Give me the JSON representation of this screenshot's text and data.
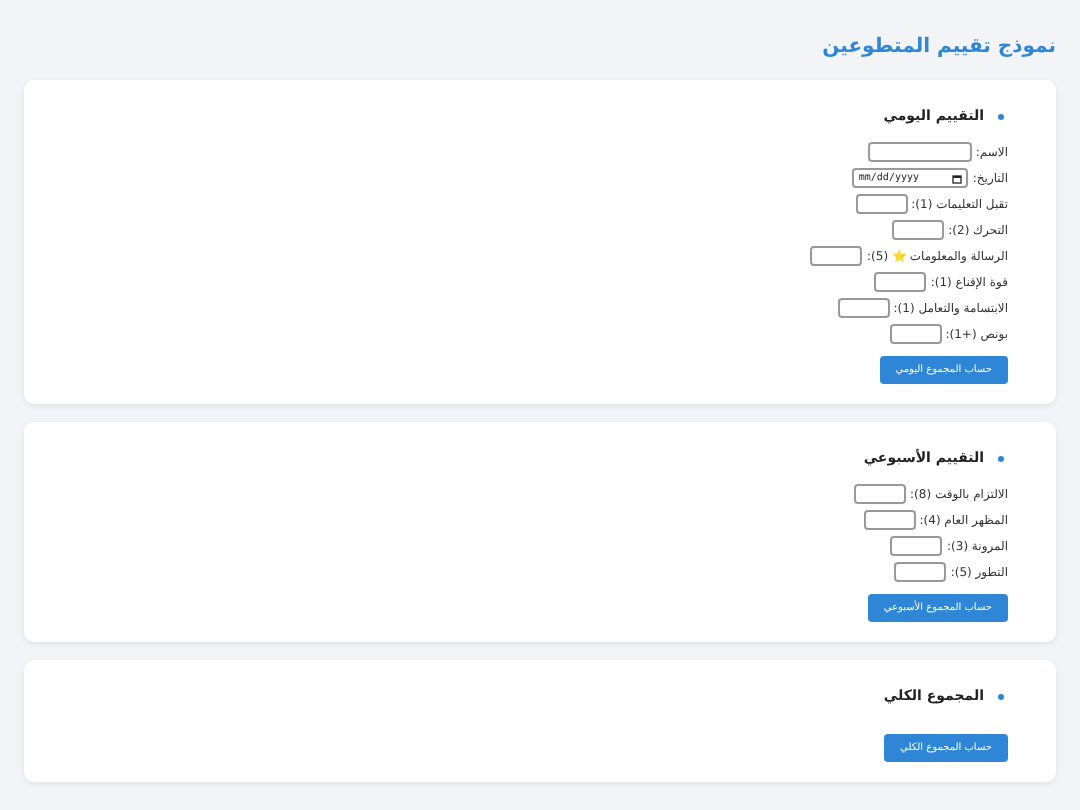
{
  "title": "نموذج تقييم المتطوعين",
  "sections": [
    {
      "heading": "التقييم اليومي",
      "fields": [
        {
          "kind": "text",
          "label": "الاسم:"
        },
        {
          "kind": "date",
          "label": "التاريخ:",
          "placeholder": "mm/dd/yyyy"
        },
        {
          "kind": "score",
          "label": "تقبل التعليمات (1):"
        },
        {
          "kind": "score",
          "label": "التحرك (2):"
        },
        {
          "kind": "score",
          "label": "الرسالة والمعلومات ⭐ (5):"
        },
        {
          "kind": "score",
          "label": "قوة الإقناع (1):"
        },
        {
          "kind": "score",
          "label": "الابتسامة والتعامل (1):"
        },
        {
          "kind": "score",
          "label": "بونص (+1):"
        }
      ],
      "button": "حساب المجموع اليومي"
    },
    {
      "heading": "التقييم الأسبوعي",
      "fields": [
        {
          "kind": "score",
          "label": "الالتزام بالوقت (8):"
        },
        {
          "kind": "score",
          "label": "المظهر العام (4):"
        },
        {
          "kind": "score",
          "label": "المرونة (3):"
        },
        {
          "kind": "score",
          "label": "التطور (5):"
        }
      ],
      "button": "حساب المجموع الأسبوعي"
    },
    {
      "heading": "المجموع الكلي",
      "button": "حساب المجموع الكلي"
    }
  ]
}
